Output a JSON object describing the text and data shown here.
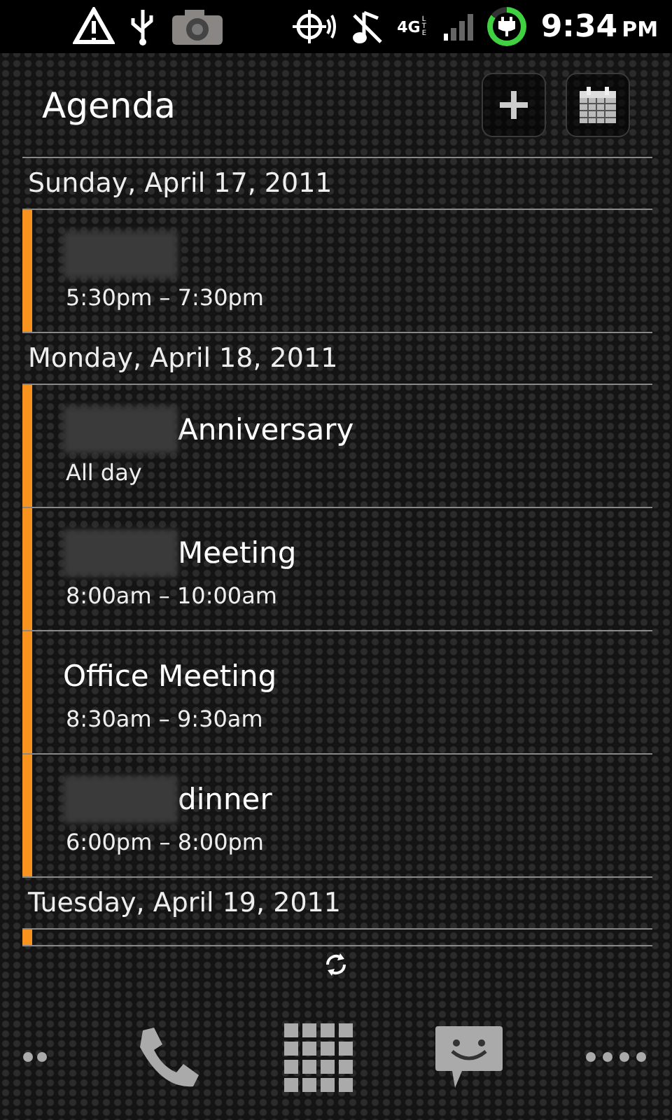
{
  "status_bar": {
    "network": "4G",
    "network_sub": "LTE",
    "time": "9:34",
    "ampm": "PM"
  },
  "header": {
    "title": "Agenda"
  },
  "days": [
    {
      "date": "Sunday, April 17, 2011",
      "events": [
        {
          "redacted": true,
          "time": "5:30pm – 7:30pm",
          "color": "#f7931e"
        }
      ]
    },
    {
      "date": "Monday, April 18, 2011",
      "events": [
        {
          "redacted": true,
          "title": "Anniversary",
          "time": "All day",
          "color": "#f7931e"
        },
        {
          "redacted": true,
          "title": "Meeting",
          "time": "8:00am – 10:00am",
          "color": "#f7931e"
        },
        {
          "redacted": false,
          "title": "Office Meeting",
          "time": "8:30am – 9:30am",
          "color": "#f7931e"
        },
        {
          "redacted": true,
          "title": "dinner",
          "time": "6:00pm – 8:00pm",
          "color": "#f7931e"
        }
      ]
    },
    {
      "date": "Tuesday, April 19, 2011",
      "events": [
        {
          "color": "#f7931e"
        }
      ]
    }
  ]
}
